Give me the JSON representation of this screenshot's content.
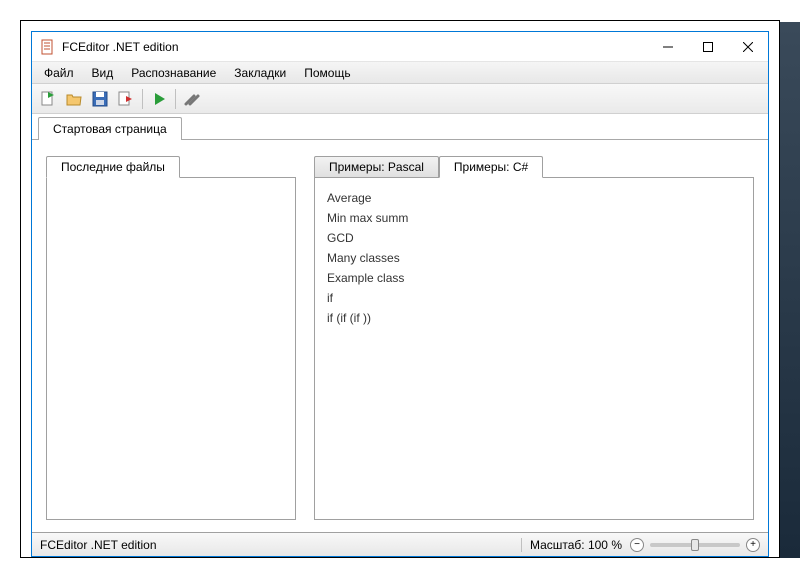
{
  "window": {
    "title": "FCEditor .NET edition"
  },
  "menu": {
    "items": [
      "Файл",
      "Вид",
      "Распознавание",
      "Закладки",
      "Помощь"
    ]
  },
  "main_tabs": {
    "items": [
      "Стартовая страница"
    ],
    "active": 0
  },
  "left_panel": {
    "tabs": [
      "Последние файлы"
    ],
    "active": 0
  },
  "right_panel": {
    "tabs": [
      "Примеры: Pascal",
      "Примеры: C#"
    ],
    "active": 1,
    "examples": [
      "Average",
      "Min max summ",
      "GCD",
      "Many classes",
      "Example class",
      "if",
      "if (if (if ))"
    ]
  },
  "statusbar": {
    "app_label": "FCEditor .NET edition",
    "zoom_label": "Масштаб: 100 %"
  },
  "toolbar_icons": [
    "new-file-icon",
    "open-folder-icon",
    "save-icon",
    "export-icon",
    "run-icon",
    "settings-icon"
  ]
}
